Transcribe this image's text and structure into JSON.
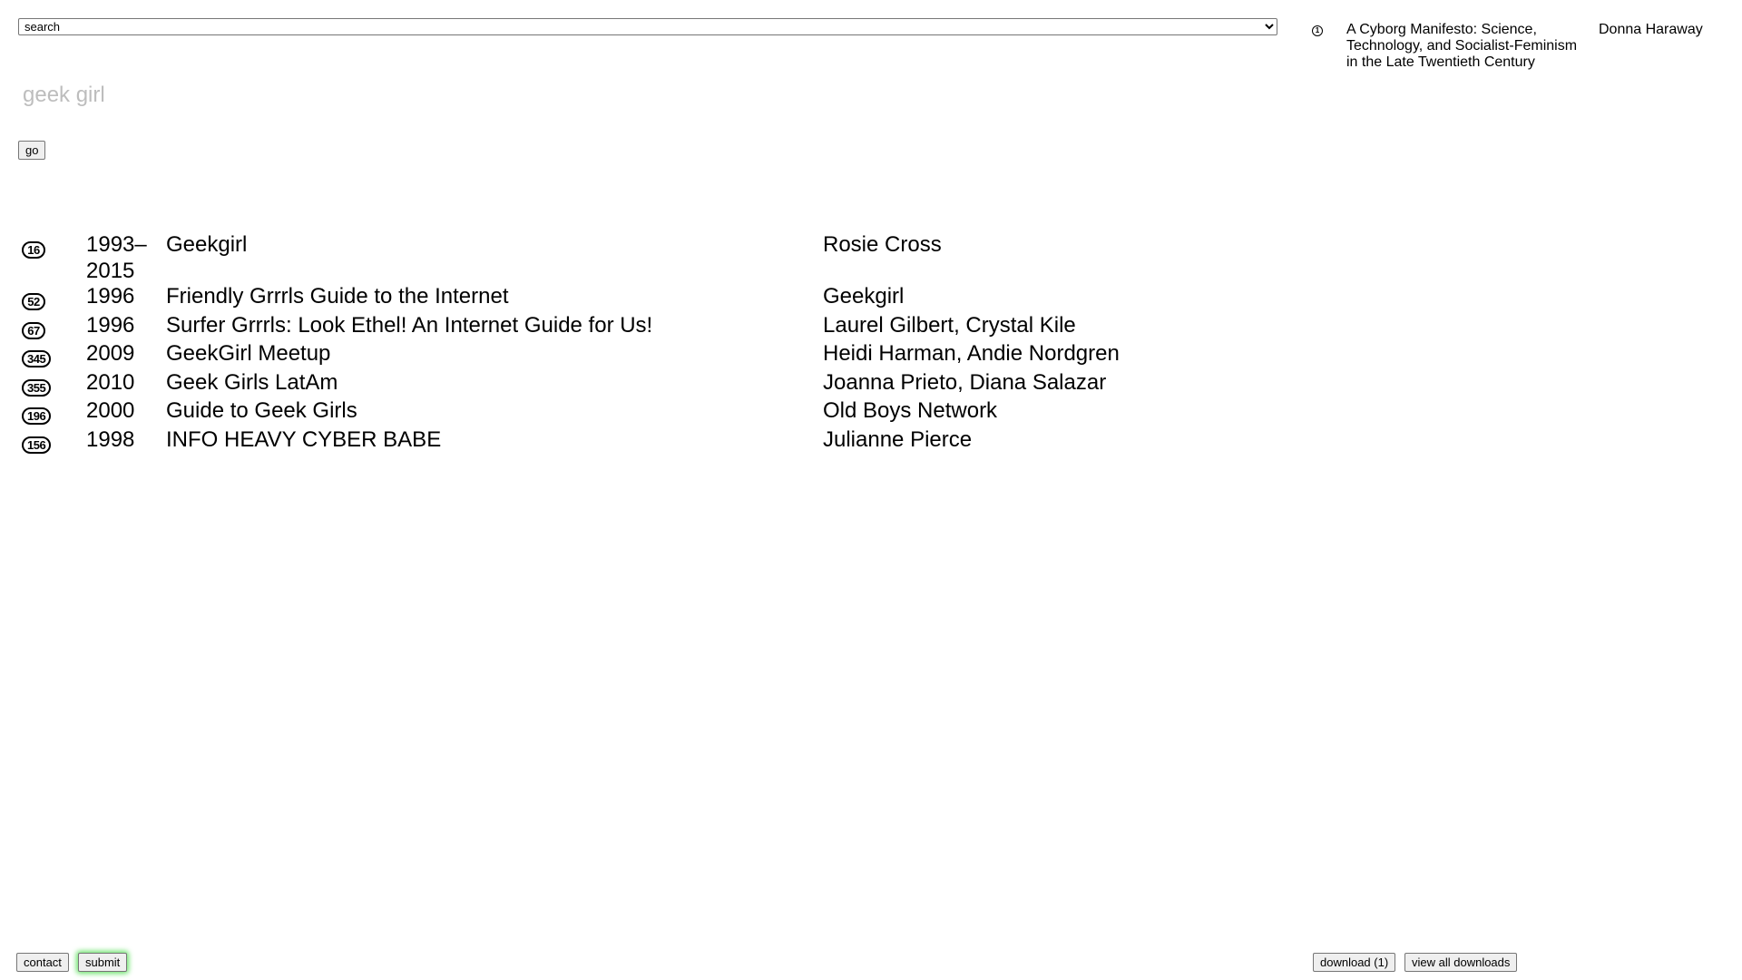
{
  "search": {
    "select_value": "search",
    "options": [
      "search"
    ],
    "input_placeholder": "geek girl",
    "input_value": "",
    "go_label": "go"
  },
  "results": [
    {
      "count": "16",
      "year": "1993–2015",
      "title": "Geekgirl",
      "authors": "Rosie Cross"
    },
    {
      "count": "52",
      "year": "1996",
      "title": "Friendly Grrrls Guide to the Internet",
      "authors": "Geekgirl"
    },
    {
      "count": "67",
      "year": "1996",
      "title": "Surfer Grrrls: Look Ethel! An Internet Guide for Us!",
      "authors": "Laurel Gilbert, Crystal Kile"
    },
    {
      "count": "345",
      "year": "2009",
      "title": "GeekGirl Meetup",
      "authors": "Heidi Harman, Andie Nordgren"
    },
    {
      "count": "355",
      "year": "2010",
      "title": "Geek Girls LatAm",
      "authors": "Joanna Prieto, Diana Salazar"
    },
    {
      "count": "196",
      "year": "2000",
      "title": "Guide to Geek Girls",
      "authors": "Old Boys Network"
    },
    {
      "count": "156",
      "year": "1998",
      "title": "INFO HEAVY CYBER BABE",
      "authors": "Julianne Pierce"
    }
  ],
  "selected": {
    "count": "1",
    "title": "A Cyborg Manifesto: Science, Technology, and Socialist-Feminism in the Late Twentieth Century",
    "author": "Donna Haraway"
  },
  "footer": {
    "contact_label": "contact",
    "submit_label": "submit",
    "download_label": "download (1)",
    "view_all_label": "view all downloads"
  },
  "colors": {
    "placeholder": "#bdbdbd",
    "submit_glow": "#6be36b",
    "button_bg": "#efefef"
  }
}
